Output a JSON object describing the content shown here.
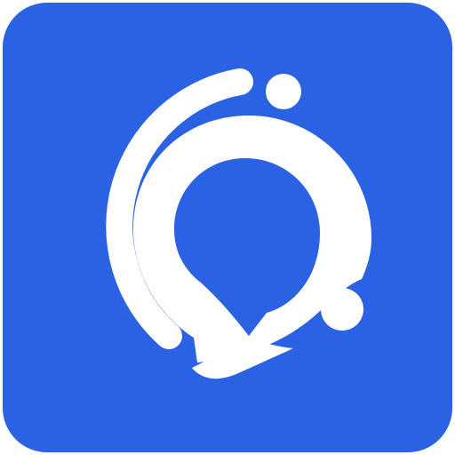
{
  "icon": {
    "name": "chat-bubble-orbit-app-icon",
    "colors": {
      "background": "#2B62E3",
      "foreground": "#FFFFFF",
      "page": "#FFFFFF"
    }
  }
}
